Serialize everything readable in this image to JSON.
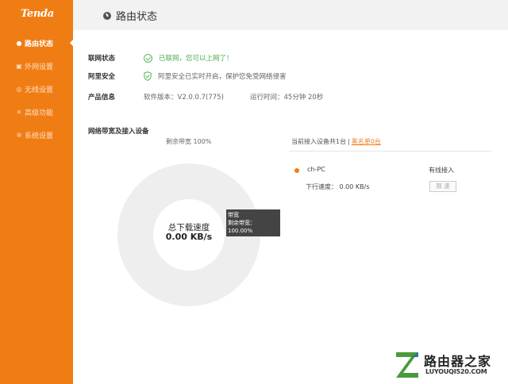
{
  "brand": {
    "logo": "Tenda",
    "accent": "#f07d14"
  },
  "sidebar": {
    "items": [
      {
        "label": "路由状态",
        "icon": "status-icon",
        "active": true
      },
      {
        "label": "外网设置",
        "icon": "wan-icon",
        "active": false
      },
      {
        "label": "无线设置",
        "icon": "wifi-icon",
        "active": false
      },
      {
        "label": "高级功能",
        "icon": "tools-icon",
        "active": false
      },
      {
        "label": "系统设置",
        "icon": "gear-icon",
        "active": false
      }
    ]
  },
  "header": {
    "title": "路由状态"
  },
  "status": {
    "network": {
      "label": "联网状态",
      "value": "已联网，您可以上网了！"
    },
    "security": {
      "label": "阿里安全",
      "value": "阿里安全已实时开启，保护您免受网络侵害"
    },
    "product": {
      "label": "产品信息",
      "firmware": "软件版本：V2.0.0.7(775)",
      "uptime": "运行时间：45分钟 20秒"
    }
  },
  "bandwidth": {
    "section_title": "网络带宽及接入设备",
    "remaining": "剩余带宽 100%",
    "speed_label": "总下载速度",
    "speed_value": "0.00 KB/s",
    "tooltip_title": "带宽",
    "tooltip_value": "剩余带宽：100.00%",
    "remaining_fraction": 1.0
  },
  "devices": {
    "count_text": "当前接入设备共1台",
    "separator": "|",
    "blacklist": "黑名单0台",
    "list": [
      {
        "name": "ch-PC",
        "connection": "有线接入",
        "speed": "下行速度： 0.00 KB/s",
        "limit_label": "限 速"
      }
    ]
  },
  "watermark": {
    "title": "路由器之家",
    "url": "LUYOUQI520.COM"
  }
}
